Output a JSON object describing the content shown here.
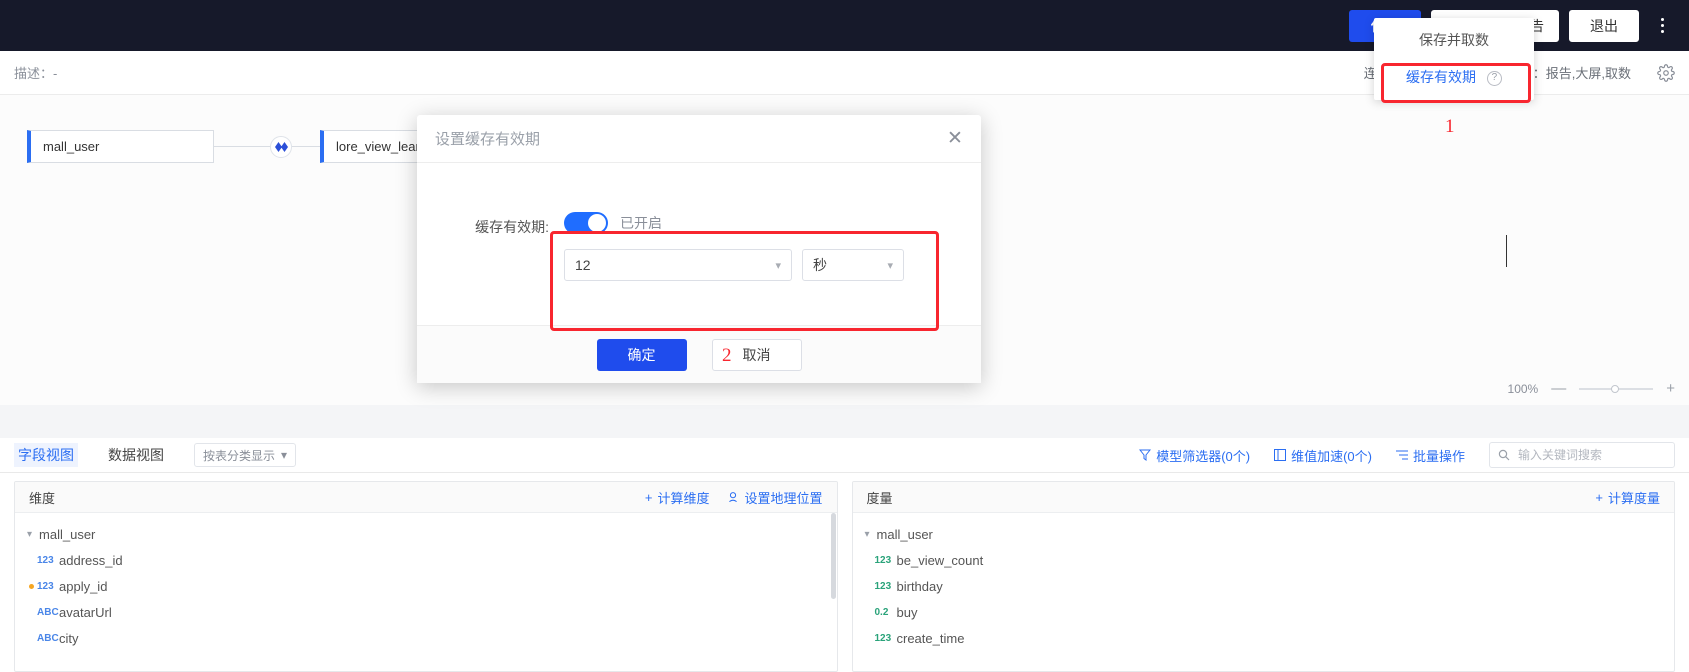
{
  "topbar": {
    "save_label": "保存",
    "save_new_report_label": "保存并新建报告",
    "exit_label": "退出",
    "more_icon": "kebab-menu-icon"
  },
  "dropdown": {
    "items": [
      {
        "label": "保存并取数",
        "accent": false,
        "help": ""
      },
      {
        "label": "缓存有效期",
        "accent": true,
        "help": "?"
      }
    ]
  },
  "annotations": {
    "step1": "1",
    "step2": "2"
  },
  "subheader": {
    "description": "描述：-",
    "connection_mode": "连接方式：直连",
    "apply_scope": "应用范围：报告,大屏,取数",
    "settings_icon": "gear-icon"
  },
  "canvas": {
    "nodes": [
      {
        "name": "mall_user"
      },
      {
        "name": "lore_view_learn"
      }
    ],
    "join_icon": "join-relation-icon",
    "zoom": {
      "level": "100%",
      "minus_icon": "minus-icon",
      "plus_icon": "plus-icon"
    }
  },
  "modal": {
    "title": "设置缓存有效期",
    "close_icon": "close-icon",
    "field_label": "缓存有效期:",
    "toggle_state_text": "已开启",
    "duration_value": "12",
    "unit_value": "秒",
    "chevron_icon": "chevron-down-icon",
    "confirm_label": "确定",
    "cancel_label": "取消"
  },
  "tabsbar": {
    "tabs": [
      {
        "label": "字段视图",
        "active": true
      },
      {
        "label": "数据视图",
        "active": false
      }
    ],
    "group_select_label": "按表分类显示",
    "links": [
      {
        "icon": "filter-icon",
        "label": "模型筛选器(0个)"
      },
      {
        "icon": "dimension-accel-icon",
        "label": "维值加速(0个)"
      },
      {
        "icon": "batch-op-icon",
        "label": "批量操作"
      }
    ],
    "search": {
      "placeholder": "输入关键词搜索",
      "value": "",
      "icon": "search-icon"
    }
  },
  "dimension_panel": {
    "title": "维度",
    "actions": [
      {
        "icon": "plus-icon",
        "label": "计算维度"
      },
      {
        "icon": "geo-location-icon",
        "label": "设置地理位置"
      }
    ],
    "group": "mall_user",
    "fields": [
      {
        "type": "123",
        "name": "address_id",
        "marked": false
      },
      {
        "type": "123",
        "name": "apply_id",
        "marked": true
      },
      {
        "type": "ABC",
        "name": "avatarUrl",
        "marked": false
      },
      {
        "type": "ABC",
        "name": "city",
        "marked": false
      }
    ]
  },
  "measure_panel": {
    "title": "度量",
    "actions": [
      {
        "icon": "plus-icon",
        "label": "计算度量"
      }
    ],
    "group": "mall_user",
    "fields": [
      {
        "type": "123",
        "name": "be_view_count",
        "marked": false
      },
      {
        "type": "123",
        "name": "birthday",
        "marked": false
      },
      {
        "type": "0.2",
        "name": "buy",
        "marked": false
      },
      {
        "type": "123",
        "name": "create_time",
        "marked": false
      }
    ]
  },
  "colors": {
    "accent": "#2b6ef2",
    "primary_button": "#1f4ced",
    "highlight": "#f8262f",
    "topbar_bg": "#16192a",
    "dimension_type": "#4a86e8",
    "measure_type": "#2aa37a",
    "marker_dot": "#f5a623"
  }
}
